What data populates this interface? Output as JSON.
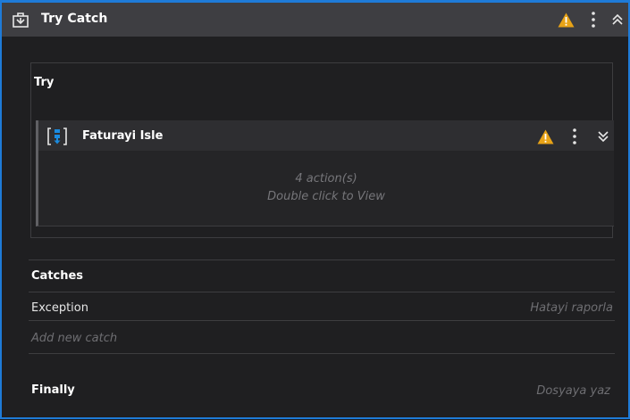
{
  "activity": {
    "title": "Try Catch",
    "icon": "try-catch-icon",
    "header_icons": [
      "warning-icon",
      "more-options-icon",
      "collapse-icon"
    ]
  },
  "try_block": {
    "label": "Try",
    "sequence": {
      "title": "Faturayi Isle",
      "icon": "sequence-icon",
      "actions_text": "4 action(s)",
      "hint_text": "Double click to View",
      "header_icons": [
        "warning-icon",
        "more-options-icon",
        "expand-icon"
      ]
    }
  },
  "catches": {
    "label": "Catches",
    "items": [
      {
        "exception": "Exception",
        "handler": "Hatayi raporla"
      }
    ],
    "add_placeholder": "Add new catch"
  },
  "finally_block": {
    "label": "Finally",
    "handler": "Dosyaya yaz"
  },
  "colors": {
    "accent_border": "#1e7bd8",
    "warning": "#e8a317",
    "seq_icon_blue": "#1a8be0"
  }
}
